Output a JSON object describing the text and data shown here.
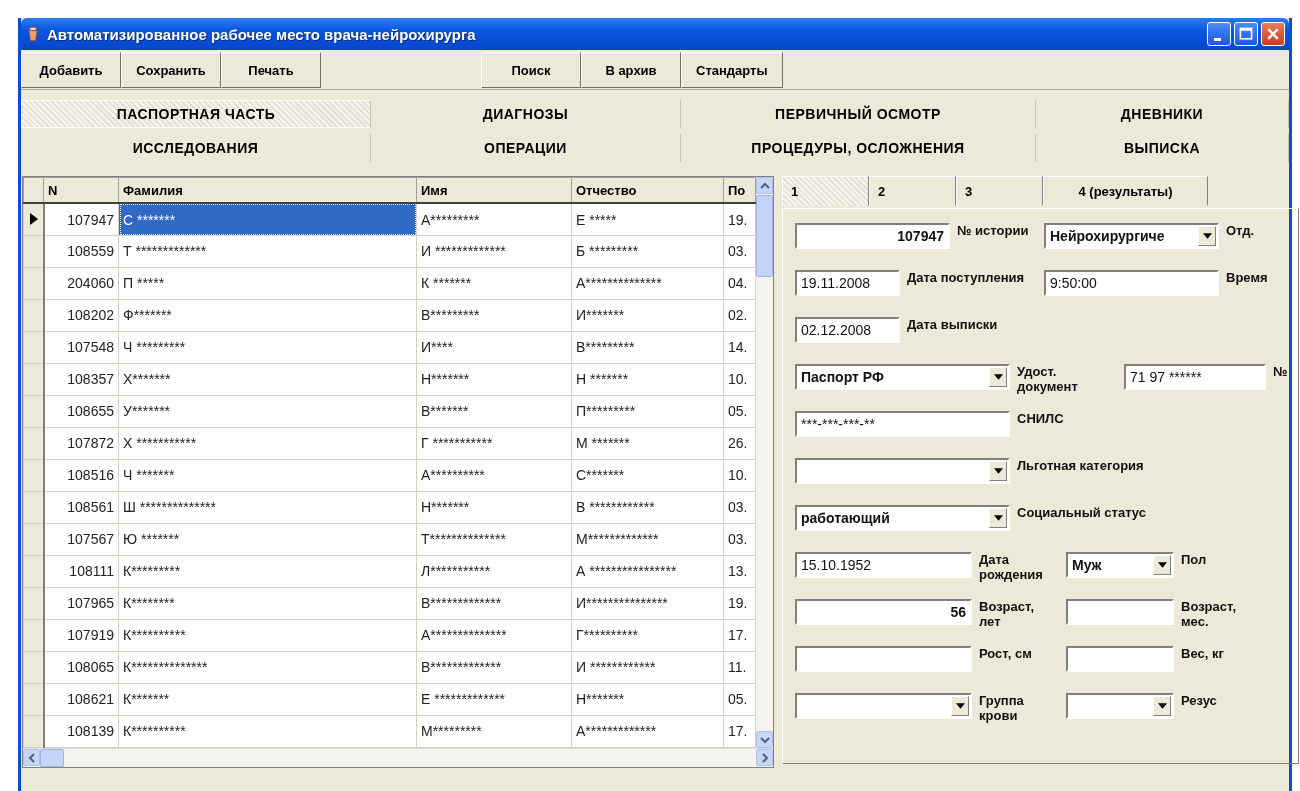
{
  "window": {
    "title": "Автоматизированное рабочее место врача-нейрохирурга"
  },
  "toolbar_left": [
    {
      "label": "Добавить"
    },
    {
      "label": "Сохранить"
    },
    {
      "label": "Печать"
    }
  ],
  "toolbar_right": [
    {
      "label": "Поиск"
    },
    {
      "label": "В архив"
    },
    {
      "label": "Стандарты"
    }
  ],
  "sections": [
    {
      "label": "ПАСПОРТНАЯ ЧАСТЬ",
      "selected": true
    },
    {
      "label": "ДИАГНОЗЫ",
      "selected": false
    },
    {
      "label": "ПЕРВИЧНЫЙ ОСМОТР",
      "selected": false
    },
    {
      "label": "ДНЕВНИКИ",
      "selected": false
    },
    {
      "label": "ИССЛЕДОВАНИЯ",
      "selected": false
    },
    {
      "label": "ОПЕРАЦИИ",
      "selected": false
    },
    {
      "label": "ПРОЦЕДУРЫ, ОСЛОЖНЕНИЯ",
      "selected": false
    },
    {
      "label": "ВЫПИСКА",
      "selected": false
    }
  ],
  "table": {
    "columns": [
      "N",
      "Фамилия",
      "Имя",
      "Отчество",
      "По"
    ],
    "rows": [
      {
        "selected": true,
        "cells": [
          "107947",
          "С *******",
          "А*********",
          "Е *****",
          "19."
        ]
      },
      {
        "selected": false,
        "cells": [
          "108559",
          "Т *************",
          "И *************",
          "Б *********",
          "03."
        ]
      },
      {
        "selected": false,
        "cells": [
          "204060",
          "П *****",
          "К *******",
          "А**************",
          "04."
        ]
      },
      {
        "selected": false,
        "cells": [
          "108202",
          "Ф*******",
          "В*********",
          "И*******",
          "02."
        ]
      },
      {
        "selected": false,
        "cells": [
          "107548",
          "Ч *********",
          "И****",
          "В*********",
          "14."
        ]
      },
      {
        "selected": false,
        "cells": [
          "108357",
          "Х*******",
          "Н*******",
          "Н *******",
          "10."
        ]
      },
      {
        "selected": false,
        "cells": [
          "108655",
          "У*******",
          "В*******",
          "П*********",
          "05."
        ]
      },
      {
        "selected": false,
        "cells": [
          "107872",
          "Х ***********",
          "Г ***********",
          "М *******",
          "26."
        ]
      },
      {
        "selected": false,
        "cells": [
          "108516",
          "Ч *******",
          "А**********",
          "С*******",
          "10."
        ]
      },
      {
        "selected": false,
        "cells": [
          "108561",
          "Ш **************",
          "Н*******",
          "В ************",
          "03."
        ]
      },
      {
        "selected": false,
        "cells": [
          "107567",
          "Ю *******",
          "Т**************",
          "М*************",
          "03."
        ]
      },
      {
        "selected": false,
        "cells": [
          "108111",
          "К*********",
          "Л***********",
          "А ****************",
          "13."
        ]
      },
      {
        "selected": false,
        "cells": [
          "107965",
          "К********",
          "В*************",
          "И***************",
          "19."
        ]
      },
      {
        "selected": false,
        "cells": [
          "107919",
          "К**********",
          "А**************",
          "Г**********",
          "17."
        ]
      },
      {
        "selected": false,
        "cells": [
          "108065",
          "К**************",
          "В*************",
          "И ************",
          "11."
        ]
      },
      {
        "selected": false,
        "cells": [
          "108621",
          "К*******",
          "Е *************",
          "Н*******",
          "05."
        ]
      },
      {
        "selected": false,
        "cells": [
          "108139",
          "К**********",
          "М*********",
          "А*************",
          "17."
        ]
      }
    ]
  },
  "form_tabs": [
    {
      "label": "1",
      "selected": true
    },
    {
      "label": "2",
      "selected": false
    },
    {
      "label": "3",
      "selected": false
    },
    {
      "label": "4 (результаты)",
      "selected": false
    }
  ],
  "form": {
    "rows": [
      [
        {
          "kind": "number",
          "value": "107947"
        },
        {
          "kind": "label",
          "text": "№ истории"
        },
        {
          "kind": "combo",
          "value": "Нейрохирургиче"
        },
        {
          "kind": "label",
          "text": "Отд."
        }
      ],
      [
        {
          "kind": "field",
          "value": "19.11.2008"
        },
        {
          "kind": "label",
          "text": "Дата поступления"
        },
        {
          "kind": "field",
          "value": "9:50:00"
        },
        {
          "kind": "label",
          "text": "Время"
        }
      ],
      [
        {
          "kind": "field",
          "value": "02.12.2008"
        },
        {
          "kind": "label",
          "text": "Дата выписки"
        }
      ],
      [
        {
          "kind": "combo",
          "value": "Паспорт РФ"
        },
        {
          "kind": "label",
          "text": "Удост. документ"
        },
        {
          "kind": "field",
          "value": "71 97 ******"
        },
        {
          "kind": "label",
          "text": "№"
        }
      ],
      [
        {
          "kind": "field",
          "value": "***-***-***-**"
        },
        {
          "kind": "label",
          "text": "СНИЛС"
        }
      ],
      [
        {
          "kind": "combo"
        },
        {
          "kind": "label",
          "text": "Льготная категория"
        }
      ],
      [
        {
          "kind": "combo",
          "value": "работающий"
        },
        {
          "kind": "label",
          "text": "Социальный статус"
        }
      ],
      [
        {
          "kind": "field",
          "value": "15.10.1952"
        },
        {
          "kind": "label",
          "text": "Дата рождения"
        },
        {
          "kind": "combo",
          "value": "Муж"
        },
        {
          "kind": "label",
          "text": "Пол"
        }
      ],
      [
        {
          "kind": "number",
          "value": "56"
        },
        {
          "kind": "label",
          "text": "Возраст, лет"
        },
        {
          "kind": "field"
        },
        {
          "kind": "label",
          "text": "Возраст, мес."
        }
      ],
      [
        {
          "kind": "field"
        },
        {
          "kind": "label",
          "text": "Рост, см"
        },
        {
          "kind": "field"
        },
        {
          "kind": "label",
          "text": "Вес, кг"
        }
      ],
      [
        {
          "kind": "combo"
        },
        {
          "kind": "label",
          "text": "Группа крови"
        },
        {
          "kind": "combo"
        },
        {
          "kind": "label",
          "text": "Резус"
        }
      ]
    ]
  }
}
